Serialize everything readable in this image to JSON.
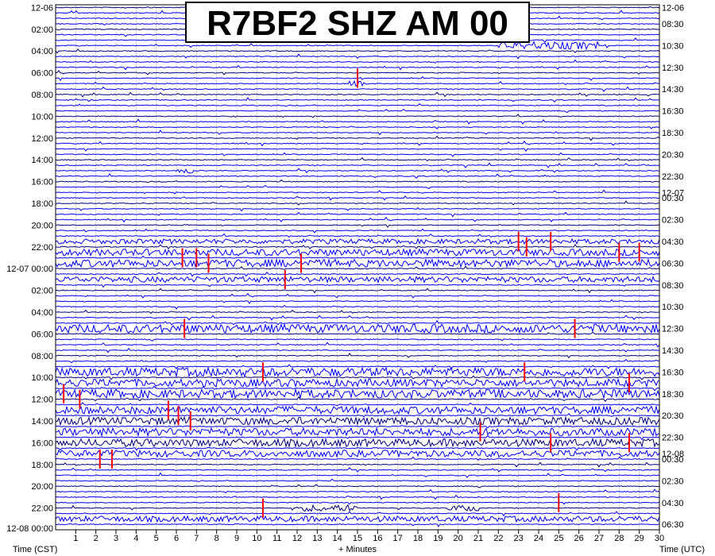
{
  "chart_data": {
    "type": "helicorder",
    "title": "R7BF2 SHZ AM 00",
    "xlabel": "+ Minutes",
    "left_axis_label": "Time (CST)",
    "right_axis_label": "Time (UTC)",
    "xlim": [
      0,
      30
    ],
    "x_ticks": [
      1,
      2,
      3,
      4,
      5,
      6,
      7,
      8,
      9,
      10,
      11,
      12,
      13,
      14,
      15,
      16,
      17,
      18,
      19,
      20,
      21,
      22,
      23,
      24,
      25,
      26,
      27,
      28,
      29,
      30
    ],
    "minutes_per_line": 30,
    "line_count": 96,
    "trace_colors": [
      "#000080",
      "#0000ff",
      "#0000ff",
      "#0000ff"
    ],
    "clip_color": "#ff0000",
    "left_labels": [
      {
        "line": 0,
        "text": "12-06"
      },
      {
        "line": 4,
        "text": "02:00"
      },
      {
        "line": 8,
        "text": "04:00"
      },
      {
        "line": 12,
        "text": "06:00"
      },
      {
        "line": 16,
        "text": "08:00"
      },
      {
        "line": 20,
        "text": "10:00"
      },
      {
        "line": 24,
        "text": "12:00"
      },
      {
        "line": 28,
        "text": "14:00"
      },
      {
        "line": 32,
        "text": "16:00"
      },
      {
        "line": 36,
        "text": "18:00"
      },
      {
        "line": 40,
        "text": "20:00"
      },
      {
        "line": 44,
        "text": "22:00"
      },
      {
        "line": 48,
        "text": "12-07 00:00"
      },
      {
        "line": 52,
        "text": "02:00"
      },
      {
        "line": 56,
        "text": "04:00"
      },
      {
        "line": 60,
        "text": "06:00"
      },
      {
        "line": 64,
        "text": "08:00"
      },
      {
        "line": 68,
        "text": "10:00"
      },
      {
        "line": 72,
        "text": "12:00"
      },
      {
        "line": 76,
        "text": "14:00"
      },
      {
        "line": 80,
        "text": "16:00"
      },
      {
        "line": 84,
        "text": "18:00"
      },
      {
        "line": 88,
        "text": "20:00"
      },
      {
        "line": 92,
        "text": "22:00"
      },
      {
        "line": 96,
        "text": "12-08 00:00"
      }
    ],
    "right_labels": [
      {
        "line": 0,
        "text": "12-06"
      },
      {
        "line": 3,
        "text": "08:30"
      },
      {
        "line": 7,
        "text": "10:30"
      },
      {
        "line": 11,
        "text": "12:30"
      },
      {
        "line": 15,
        "text": "14:30"
      },
      {
        "line": 19,
        "text": "16:30"
      },
      {
        "line": 23,
        "text": "18:30"
      },
      {
        "line": 27,
        "text": "20:30"
      },
      {
        "line": 31,
        "text": "22:30"
      },
      {
        "line": 34,
        "text": "12-07"
      },
      {
        "line": 35,
        "text": "00:30"
      },
      {
        "line": 39,
        "text": "02:30"
      },
      {
        "line": 43,
        "text": "04:30"
      },
      {
        "line": 47,
        "text": "06:30"
      },
      {
        "line": 51,
        "text": "08:30"
      },
      {
        "line": 55,
        "text": "10:30"
      },
      {
        "line": 59,
        "text": "12:30"
      },
      {
        "line": 63,
        "text": "14:30"
      },
      {
        "line": 67,
        "text": "16:30"
      },
      {
        "line": 71,
        "text": "18:30"
      },
      {
        "line": 75,
        "text": "20:30"
      },
      {
        "line": 79,
        "text": "22:30"
      },
      {
        "line": 82,
        "text": "12-08"
      },
      {
        "line": 83,
        "text": "00:30"
      },
      {
        "line": 87,
        "text": "02:30"
      },
      {
        "line": 91,
        "text": "04:30"
      },
      {
        "line": 95,
        "text": "06:30"
      }
    ],
    "activity": [
      {
        "line": 7,
        "start_min": 22,
        "end_min": 27,
        "level": 0.8
      },
      {
        "line": 14,
        "start_min": 14.5,
        "end_min": 15.5,
        "level": 0.6
      },
      {
        "line": 30,
        "start_min": 6,
        "end_min": 6.8,
        "level": 0.5
      },
      {
        "line": 43,
        "start_min": 0,
        "end_min": 30,
        "level": 0.5
      },
      {
        "line": 45,
        "start_min": 0,
        "end_min": 30,
        "level": 0.7
      },
      {
        "line": 47,
        "start_min": 0,
        "end_min": 30,
        "level": 0.8
      },
      {
        "line": 50,
        "start_min": 0,
        "end_min": 30,
        "level": 0.6
      },
      {
        "line": 59,
        "start_min": 0,
        "end_min": 30,
        "level": 0.9
      },
      {
        "line": 67,
        "start_min": 0,
        "end_min": 30,
        "level": 0.9
      },
      {
        "line": 69,
        "start_min": 0,
        "end_min": 30,
        "level": 0.8
      },
      {
        "line": 71,
        "start_min": 0,
        "end_min": 30,
        "level": 0.9
      },
      {
        "line": 74,
        "start_min": 0,
        "end_min": 30,
        "level": 0.8
      },
      {
        "line": 76,
        "start_min": 0,
        "end_min": 30,
        "level": 0.8
      },
      {
        "line": 78,
        "start_min": 0,
        "end_min": 30,
        "level": 0.8
      },
      {
        "line": 80,
        "start_min": 0,
        "end_min": 30,
        "level": 0.8
      },
      {
        "line": 82,
        "start_min": 0,
        "end_min": 30,
        "level": 0.7
      },
      {
        "line": 92,
        "start_min": 12,
        "end_min": 15,
        "level": 0.7
      },
      {
        "line": 92,
        "start_min": 19.5,
        "end_min": 21,
        "level": 0.6
      },
      {
        "line": 94,
        "start_min": 0,
        "end_min": 30,
        "level": 0.6
      }
    ],
    "clip_events": [
      {
        "line": 13,
        "minute": 15.0
      },
      {
        "line": 43,
        "minute": 23.0
      },
      {
        "line": 44,
        "minute": 23.4
      },
      {
        "line": 43,
        "minute": 24.6
      },
      {
        "line": 45,
        "minute": 28.0
      },
      {
        "line": 45,
        "minute": 29.0
      },
      {
        "line": 46,
        "minute": 6.3
      },
      {
        "line": 46,
        "minute": 7.0
      },
      {
        "line": 47,
        "minute": 7.6
      },
      {
        "line": 47,
        "minute": 12.2
      },
      {
        "line": 50,
        "minute": 11.4
      },
      {
        "line": 59,
        "minute": 6.4
      },
      {
        "line": 59,
        "minute": 25.8
      },
      {
        "line": 67,
        "minute": 10.3
      },
      {
        "line": 67,
        "minute": 23.3
      },
      {
        "line": 69,
        "minute": 28.5
      },
      {
        "line": 71,
        "minute": 0.4
      },
      {
        "line": 72,
        "minute": 1.2
      },
      {
        "line": 74,
        "minute": 5.6
      },
      {
        "line": 75,
        "minute": 6.1
      },
      {
        "line": 76,
        "minute": 6.7
      },
      {
        "line": 78,
        "minute": 21.1
      },
      {
        "line": 80,
        "minute": 24.6
      },
      {
        "line": 80,
        "minute": 28.5
      },
      {
        "line": 83,
        "minute": 2.2
      },
      {
        "line": 83,
        "minute": 2.8
      },
      {
        "line": 92,
        "minute": 10.3
      },
      {
        "line": 91,
        "minute": 25.0
      }
    ]
  }
}
